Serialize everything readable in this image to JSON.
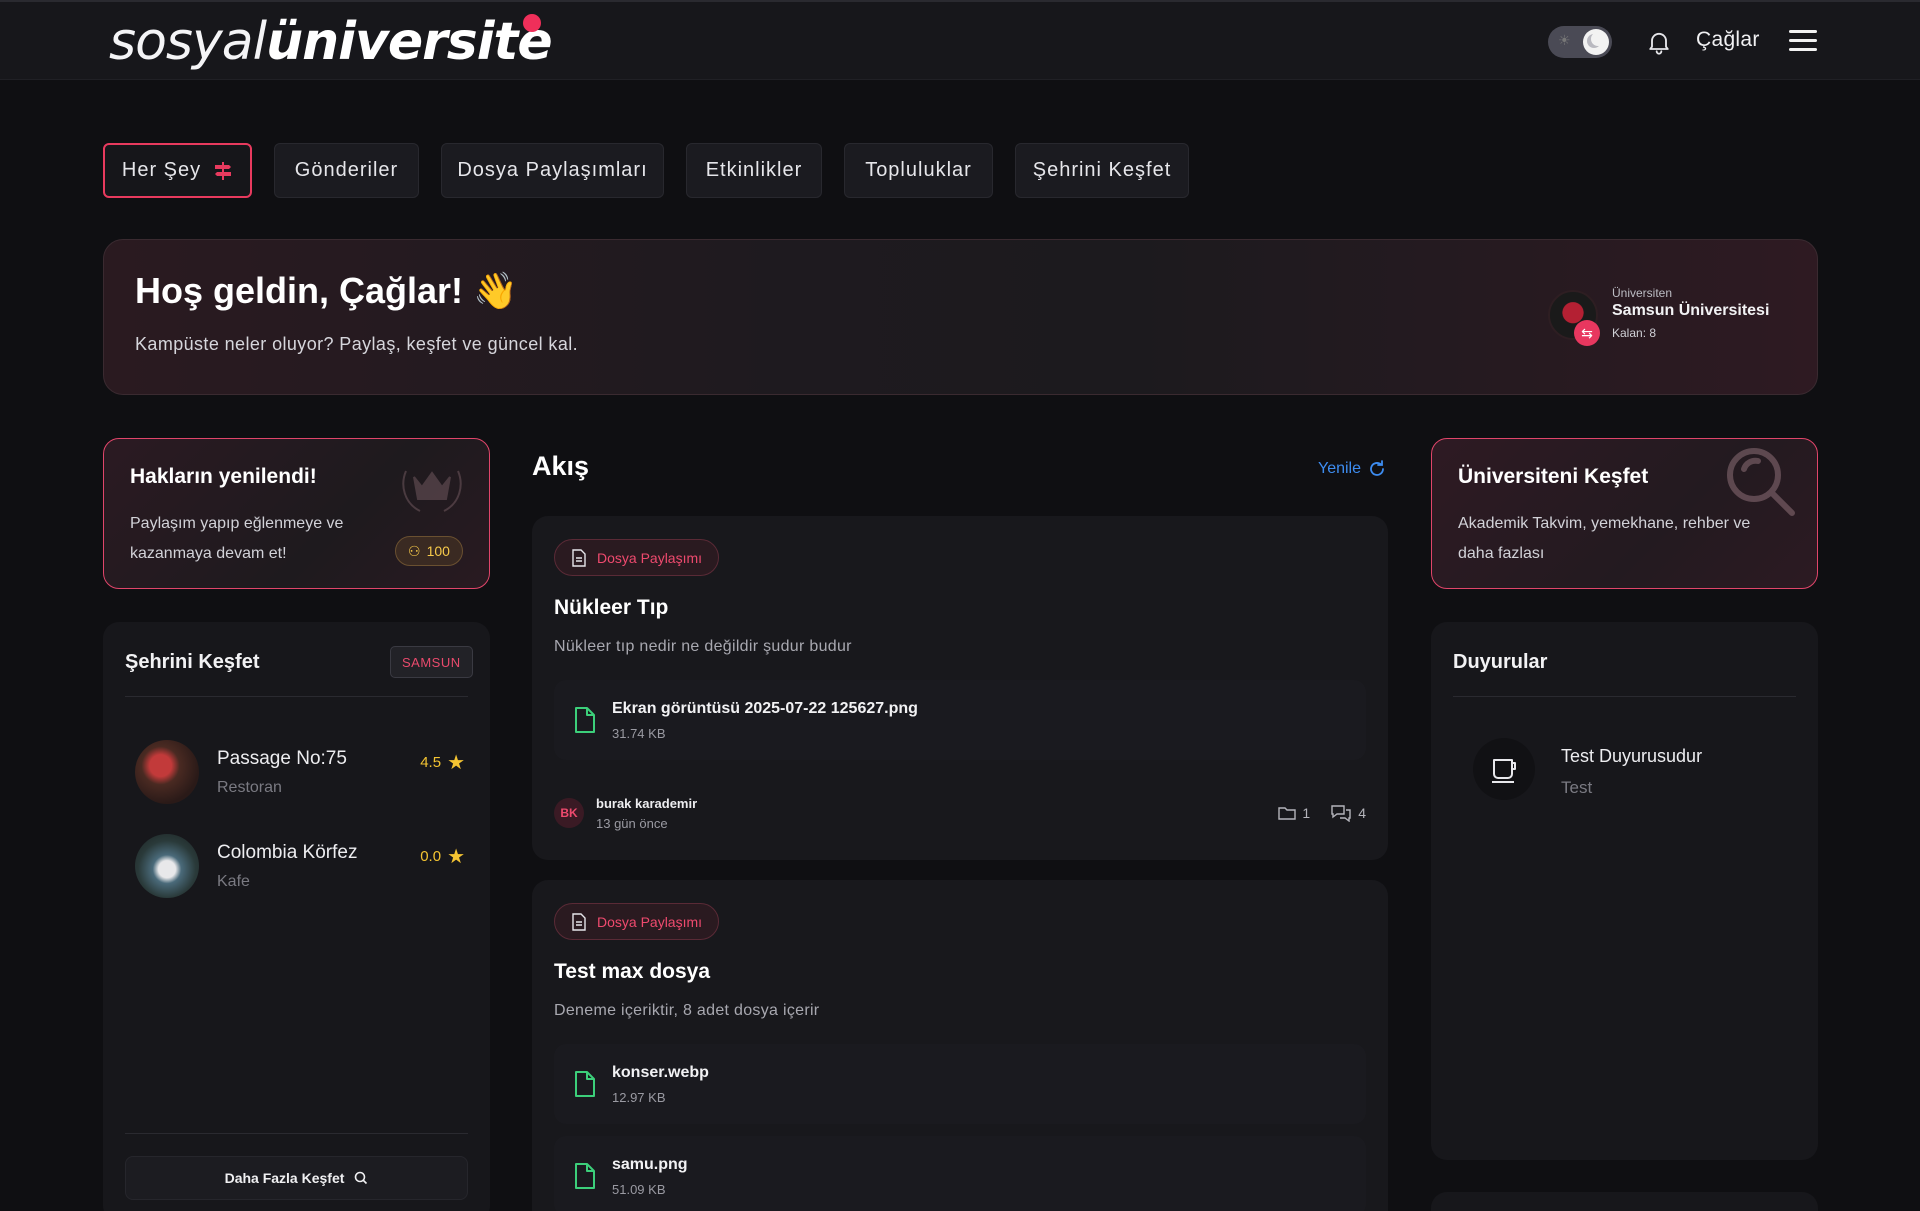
{
  "header": {
    "logo_light": "sosyal",
    "logo_bold": "üniversite",
    "user_name": "Çağlar"
  },
  "tabs": [
    {
      "label": "Her Şey",
      "active": true
    },
    {
      "label": "Gönderiler"
    },
    {
      "label": "Dosya Paylaşımları"
    },
    {
      "label": "Etkinlikler"
    },
    {
      "label": "Topluluklar"
    },
    {
      "label": "Şehrini Keşfet"
    }
  ],
  "welcome": {
    "title": "Hoş geldin, Çağlar! 👋",
    "subtitle": "Kampüste neler oluyor? Paylaş, keşfet ve güncel kal.",
    "university_caption": "Üniversiten",
    "university_name": "Samsun Üniversitesi",
    "remaining": "Kalan: 8"
  },
  "rights_card": {
    "title": "Hakların yenilendi!",
    "text": "Paylaşım yapıp eğlenmeye ve kazanmaya devam et!",
    "points": "100"
  },
  "city": {
    "title": "Şehrini Keşfet",
    "badge": "SAMSUN",
    "places": [
      {
        "name": "Passage No:75",
        "type": "Restoran",
        "rating": "4.5"
      },
      {
        "name": "Colombia Körfez",
        "type": "Kafe",
        "rating": "0.0"
      }
    ],
    "more_label": "Daha Fazla Keşfet"
  },
  "feed": {
    "title": "Akış",
    "refresh_label": "Yenile",
    "posts": [
      {
        "chip": "Dosya Paylaşımı",
        "title": "Nükleer Tıp",
        "description": "Nükleer tıp nedir ne değildir şudur budur",
        "files": [
          {
            "name": "Ekran görüntüsü 2025-07-22 125627.png",
            "size": "31.74 KB"
          }
        ],
        "author_initials": "BK",
        "author": "burak karademir",
        "time": "13 gün önce",
        "file_count": "1",
        "comment_count": "4"
      },
      {
        "chip": "Dosya Paylaşımı",
        "title": "Test max dosya",
        "description": "Deneme içeriktir, 8 adet dosya içerir",
        "files": [
          {
            "name": "konser.webp",
            "size": "12.97 KB"
          },
          {
            "name": "samu.png",
            "size": "51.09 KB"
          }
        ]
      }
    ]
  },
  "explore_card": {
    "title": "Üniversiteni Keşfet",
    "text": "Akademik Takvim, yemekhane, rehber ve daha fazlası"
  },
  "announcements": {
    "title": "Duyurular",
    "items": [
      {
        "title": "Test Duyurusudur",
        "subtitle": "Test"
      }
    ]
  },
  "colors": {
    "accent": "#e83a5e",
    "link": "#3d8cf0",
    "star": "#f4c432",
    "file_icon": "#3ccf7a"
  }
}
